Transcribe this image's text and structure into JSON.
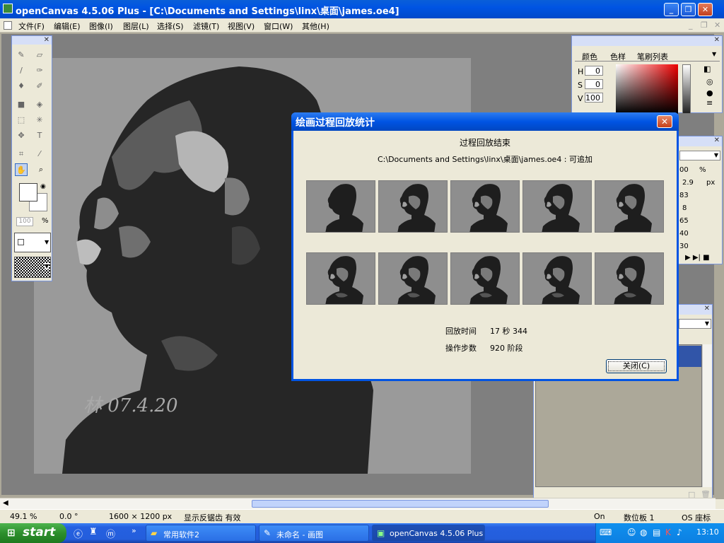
{
  "window": {
    "title": "openCanvas 4.5.06 Plus - [C:\\Documents and Settings\\linx\\桌面\\james.oe4]"
  },
  "menu": [
    "文件(F)",
    "编辑(E)",
    "图像(I)",
    "图层(L)",
    "选择(S)",
    "滤镜(T)",
    "视图(V)",
    "窗口(W)",
    "其他(H)"
  ],
  "toolbox": {
    "zoom_value": "100",
    "zoom_unit": "%"
  },
  "color_palette": {
    "tabs": [
      "颜色",
      "色样",
      "笔刷列表"
    ],
    "fields": [
      {
        "label": "H",
        "value": "0"
      },
      {
        "label": "S",
        "value": "0"
      },
      {
        "label": "V",
        "value": "100"
      }
    ]
  },
  "brush_palette": {
    "values": [
      "00",
      "2.9",
      "83",
      "8",
      "65",
      "40",
      "30"
    ],
    "unit_px": "px",
    "unit_pct": "%"
  },
  "dialog": {
    "title": "绘画过程回放统计",
    "heading": "过程回放结束",
    "path": "C:\\Documents and Settings\\linx\\桌面\\james.oe4 : 可追加",
    "stats": [
      {
        "label": "回放时间",
        "value": "17 秒 344"
      },
      {
        "label": "操作步数",
        "value": "920 阶段"
      }
    ],
    "close_label": "关闭(C)",
    "thumbnail_count": 10
  },
  "statusbar": {
    "zoom": "49.1 %",
    "angle": "0.0 °",
    "size": "1600 × 1200 px",
    "antialias": "显示反锯齿 有效",
    "on": "On",
    "tablet": "数位板 1",
    "coords": "OS 座标"
  },
  "taskbar": {
    "start": "start",
    "tasks": [
      "常用软件2",
      "未命名 - 画图",
      "openCanvas 4.5.06 Plus"
    ],
    "clock": "13:10"
  },
  "colors": {
    "xp_blue": "#0054e3",
    "start_green": "#2d8f2d",
    "face": "#ece9d8"
  }
}
